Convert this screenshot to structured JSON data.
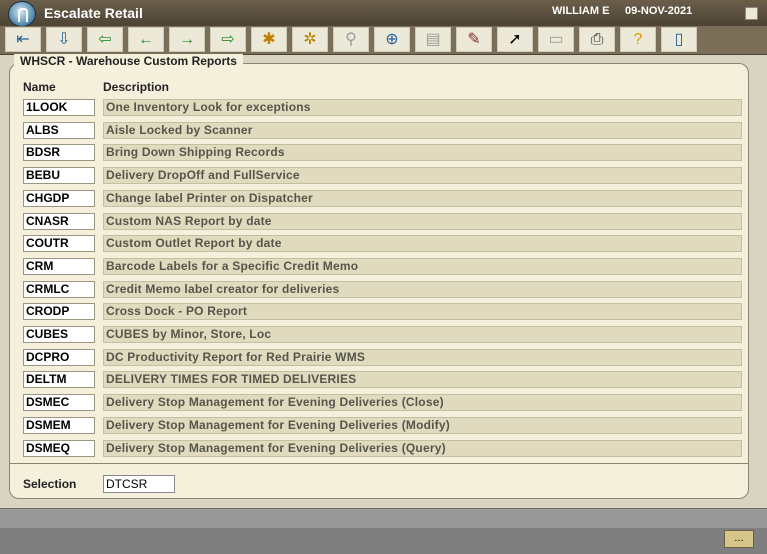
{
  "titlebar": {
    "app": "Escalate Retail",
    "user": "WILLIAM E",
    "date": "09-NOV-2021"
  },
  "toolbar": [
    {
      "name": "first-record-icon",
      "glyph": "⇤",
      "color": "#1f5f99"
    },
    {
      "name": "next-block-icon",
      "glyph": "⇩",
      "color": "#1f5f99"
    },
    {
      "name": "previous-record-icon",
      "glyph": "⇦",
      "color": "#2e8a2e"
    },
    {
      "name": "back-arrow-icon",
      "glyph": "←",
      "color": "#2e8a2e"
    },
    {
      "name": "forward-arrow-icon",
      "glyph": "→",
      "color": "#2e8a2e"
    },
    {
      "name": "next-record-icon",
      "glyph": "⇨",
      "color": "#2e8a2e"
    },
    {
      "name": "insert-record-icon",
      "glyph": "✱",
      "color": "#c08000"
    },
    {
      "name": "duplicate-record-icon",
      "glyph": "✲",
      "color": "#c08000"
    },
    {
      "name": "binoculars-icon",
      "glyph": "⚲",
      "color": "#9c9c9c",
      "disabled": true
    },
    {
      "name": "zoom-icon",
      "glyph": "⊕",
      "color": "#1f5f99"
    },
    {
      "name": "save-icon",
      "glyph": "▤",
      "color": "#9c9c9c",
      "disabled": true
    },
    {
      "name": "edit-icon",
      "glyph": "✎",
      "color": "#8a2a2a"
    },
    {
      "name": "select-pointer-icon",
      "glyph": "➚",
      "color": "#000000"
    },
    {
      "name": "clear-icon",
      "glyph": "▭",
      "color": "#9c9c9c",
      "disabled": true
    },
    {
      "name": "print-icon",
      "glyph": "⎙",
      "color": "#333333"
    },
    {
      "name": "help-icon",
      "glyph": "?",
      "color": "#d4a000"
    },
    {
      "name": "exit-icon",
      "glyph": "▯",
      "color": "#1f5f99"
    }
  ],
  "panel": {
    "title": "WHSCR - Warehouse Custom Reports",
    "col_name": "Name",
    "col_desc": "Description"
  },
  "reports": [
    {
      "code": "1LOOK",
      "desc": "One Inventory Look for exceptions"
    },
    {
      "code": "ALBS",
      "desc": "Aisle Locked by Scanner"
    },
    {
      "code": "BDSR",
      "desc": "Bring Down Shipping Records"
    },
    {
      "code": "BEBU",
      "desc": "Delivery DropOff and FullService"
    },
    {
      "code": "CHGDP",
      "desc": "Change label Printer on Dispatcher"
    },
    {
      "code": "CNASR",
      "desc": "Custom NAS Report by date"
    },
    {
      "code": "COUTR",
      "desc": "Custom Outlet Report by date"
    },
    {
      "code": "CRM",
      "desc": "Barcode Labels for a Specific Credit Memo"
    },
    {
      "code": "CRMLC",
      "desc": "Credit Memo label creator for deliveries"
    },
    {
      "code": "CRODP",
      "desc": "Cross Dock - PO Report"
    },
    {
      "code": "CUBES",
      "desc": "CUBES by Minor, Store, Loc"
    },
    {
      "code": "DCPRO",
      "desc": "DC Productivity Report for Red Prairie WMS"
    },
    {
      "code": "DELTM",
      "desc": "DELIVERY TIMES FOR TIMED DELIVERIES"
    },
    {
      "code": "DSMEC",
      "desc": "Delivery Stop Management for Evening Deliveries (Close)"
    },
    {
      "code": "DSMEM",
      "desc": "Delivery Stop Management for Evening Deliveries (Modify)"
    },
    {
      "code": "DSMEQ",
      "desc": "Delivery Stop Management for Evening Deliveries (Query)"
    }
  ],
  "selection": {
    "label": "Selection",
    "value": "DTCSR"
  },
  "status": {
    "button": "..."
  }
}
